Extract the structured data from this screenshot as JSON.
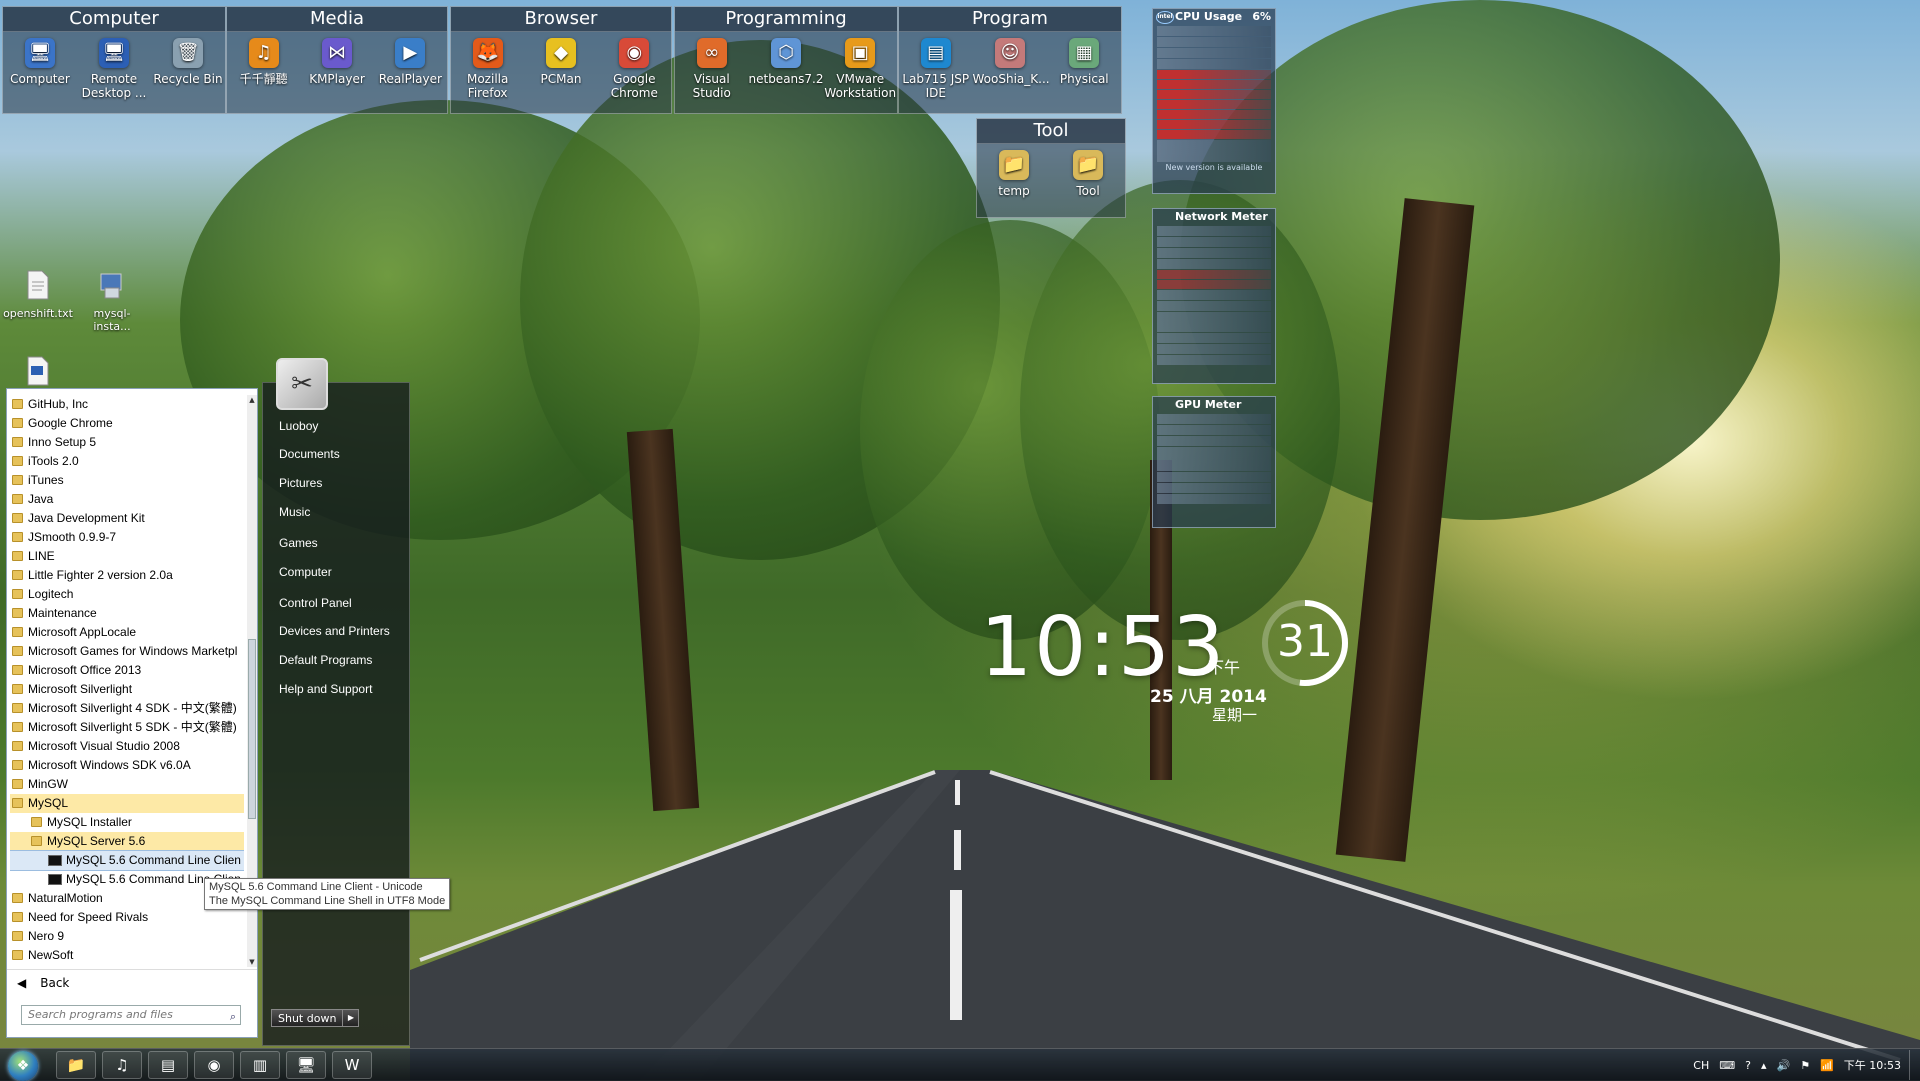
{
  "fences": [
    {
      "title": "Computer",
      "icons": [
        {
          "name": "computer",
          "label": "Computer",
          "glyph": "🖥",
          "color": "#3b74c8"
        },
        {
          "name": "remote-desktop",
          "label": "Remote Desktop ...",
          "glyph": "🖥",
          "color": "#2c5fb5"
        },
        {
          "name": "recycle-bin",
          "label": "Recycle Bin",
          "glyph": "🗑",
          "color": "#8aa0b0"
        }
      ]
    },
    {
      "title": "Media",
      "icons": [
        {
          "name": "qianqian",
          "label": "千千靜聽",
          "glyph": "♫",
          "color": "#e68a1a"
        },
        {
          "name": "kmplayer",
          "label": "KMPlayer",
          "glyph": "⋈",
          "color": "#6a5acd"
        },
        {
          "name": "realplayer",
          "label": "RealPlayer",
          "glyph": "▶",
          "color": "#3a7ec8"
        }
      ]
    },
    {
      "title": "Browser",
      "icons": [
        {
          "name": "firefox",
          "label": "Mozilla Firefox",
          "glyph": "🦊",
          "color": "#e35a1a"
        },
        {
          "name": "pcman",
          "label": "PCMan",
          "glyph": "◆",
          "color": "#e7c020"
        },
        {
          "name": "chrome",
          "label": "Google Chrome",
          "glyph": "◉",
          "color": "#d84a38"
        }
      ]
    },
    {
      "title": "Programming",
      "icons": [
        {
          "name": "visual-studio",
          "label": "Visual Studio",
          "glyph": "∞",
          "color": "#e06b2a"
        },
        {
          "name": "netbeans",
          "label": "netbeans7.2",
          "glyph": "⬡",
          "color": "#5f95d6"
        },
        {
          "name": "vmware",
          "label": "VMware Workstation",
          "glyph": "▣",
          "color": "#e79a1a"
        }
      ]
    },
    {
      "title": "Program",
      "icons": [
        {
          "name": "lab715",
          "label": "Lab715 JSP IDE",
          "glyph": "▤",
          "color": "#1e88d0"
        },
        {
          "name": "wooshia",
          "label": "WooShia_K...",
          "glyph": "☺",
          "color": "#c47a7a"
        },
        {
          "name": "physical",
          "label": "Physical",
          "glyph": "▦",
          "color": "#6aa87a"
        }
      ]
    }
  ],
  "tool_fence": {
    "title": "Tool",
    "icons": [
      {
        "name": "temp",
        "label": "temp",
        "glyph": "📁",
        "color": "#d9b95a"
      },
      {
        "name": "tool",
        "label": "Tool",
        "glyph": "📁",
        "color": "#d9b95a"
      }
    ]
  },
  "desktop_icons": [
    {
      "label": "openshift.txt"
    },
    {
      "label": "mysql-insta..."
    }
  ],
  "gadgets": {
    "cpu": {
      "title": "CPU Usage",
      "percent": "6%",
      "footer": "New version is available"
    },
    "network": {
      "title": "Network Meter"
    },
    "gpu": {
      "title": "GPU Meter"
    }
  },
  "clock": {
    "time": "10:53",
    "ampm": "下午",
    "date": "25 八月 2014",
    "weekday": "星期一",
    "seconds": "31",
    "seconds_fraction": 0.52
  },
  "start_menu": {
    "programs": [
      {
        "label": "GitHub, Inc",
        "level": 0
      },
      {
        "label": "Google Chrome",
        "level": 0
      },
      {
        "label": "Inno Setup 5",
        "level": 0
      },
      {
        "label": "iTools 2.0",
        "level": 0
      },
      {
        "label": "iTunes",
        "level": 0
      },
      {
        "label": "Java",
        "level": 0
      },
      {
        "label": "Java Development Kit",
        "level": 0
      },
      {
        "label": "JSmooth 0.9.9-7",
        "level": 0
      },
      {
        "label": "LINE",
        "level": 0
      },
      {
        "label": "Little Fighter 2 version 2.0a",
        "level": 0
      },
      {
        "label": "Logitech",
        "level": 0
      },
      {
        "label": "Maintenance",
        "level": 0
      },
      {
        "label": "Microsoft AppLocale",
        "level": 0
      },
      {
        "label": "Microsoft Games for Windows Marketpl",
        "level": 0
      },
      {
        "label": "Microsoft Office 2013",
        "level": 0
      },
      {
        "label": "Microsoft Silverlight",
        "level": 0
      },
      {
        "label": "Microsoft Silverlight 4 SDK - 中文(繁體)",
        "level": 0
      },
      {
        "label": "Microsoft Silverlight 5 SDK - 中文(繁體)",
        "level": 0
      },
      {
        "label": "Microsoft Visual Studio 2008",
        "level": 0
      },
      {
        "label": "Microsoft Windows SDK v6.0A",
        "level": 0
      },
      {
        "label": "MinGW",
        "level": 0
      },
      {
        "label": "MySQL",
        "level": 0,
        "state": "sel"
      },
      {
        "label": "MySQL Installer",
        "level": 1
      },
      {
        "label": "MySQL Server 5.6",
        "level": 1,
        "state": "sel"
      },
      {
        "label": "MySQL 5.6 Command Line Clien",
        "level": 2,
        "state": "hot"
      },
      {
        "label": "MySQL 5.6 Command Line Clien",
        "level": 2
      },
      {
        "label": "NaturalMotion",
        "level": 0
      },
      {
        "label": "Need for Speed Rivals",
        "level": 0
      },
      {
        "label": "Nero 9",
        "level": 0
      },
      {
        "label": "NewSoft",
        "level": 0
      }
    ],
    "back_label": "Back",
    "search_placeholder": "Search programs and files",
    "right_items": [
      "Luoboy",
      "Documents",
      "Pictures",
      "Music",
      "Games",
      "Computer",
      "Control Panel",
      "Devices and Printers",
      "Default Programs",
      "Help and Support"
    ],
    "shutdown_label": "Shut down",
    "tooltip_line1": "MySQL 5.6 Command Line Client - Unicode",
    "tooltip_line2": "The MySQL Command Line Shell in UTF8 Mode"
  },
  "taskbar": {
    "apps": [
      {
        "name": "explorer",
        "glyph": "📁"
      },
      {
        "name": "qianqian",
        "glyph": "♫"
      },
      {
        "name": "app3",
        "glyph": "▤"
      },
      {
        "name": "chrome",
        "glyph": "◉"
      },
      {
        "name": "app5",
        "glyph": "▥"
      },
      {
        "name": "app6",
        "glyph": "🖥"
      },
      {
        "name": "word",
        "glyph": "W"
      }
    ],
    "tray": {
      "lang": "CH",
      "time": "下午 10:53"
    }
  }
}
